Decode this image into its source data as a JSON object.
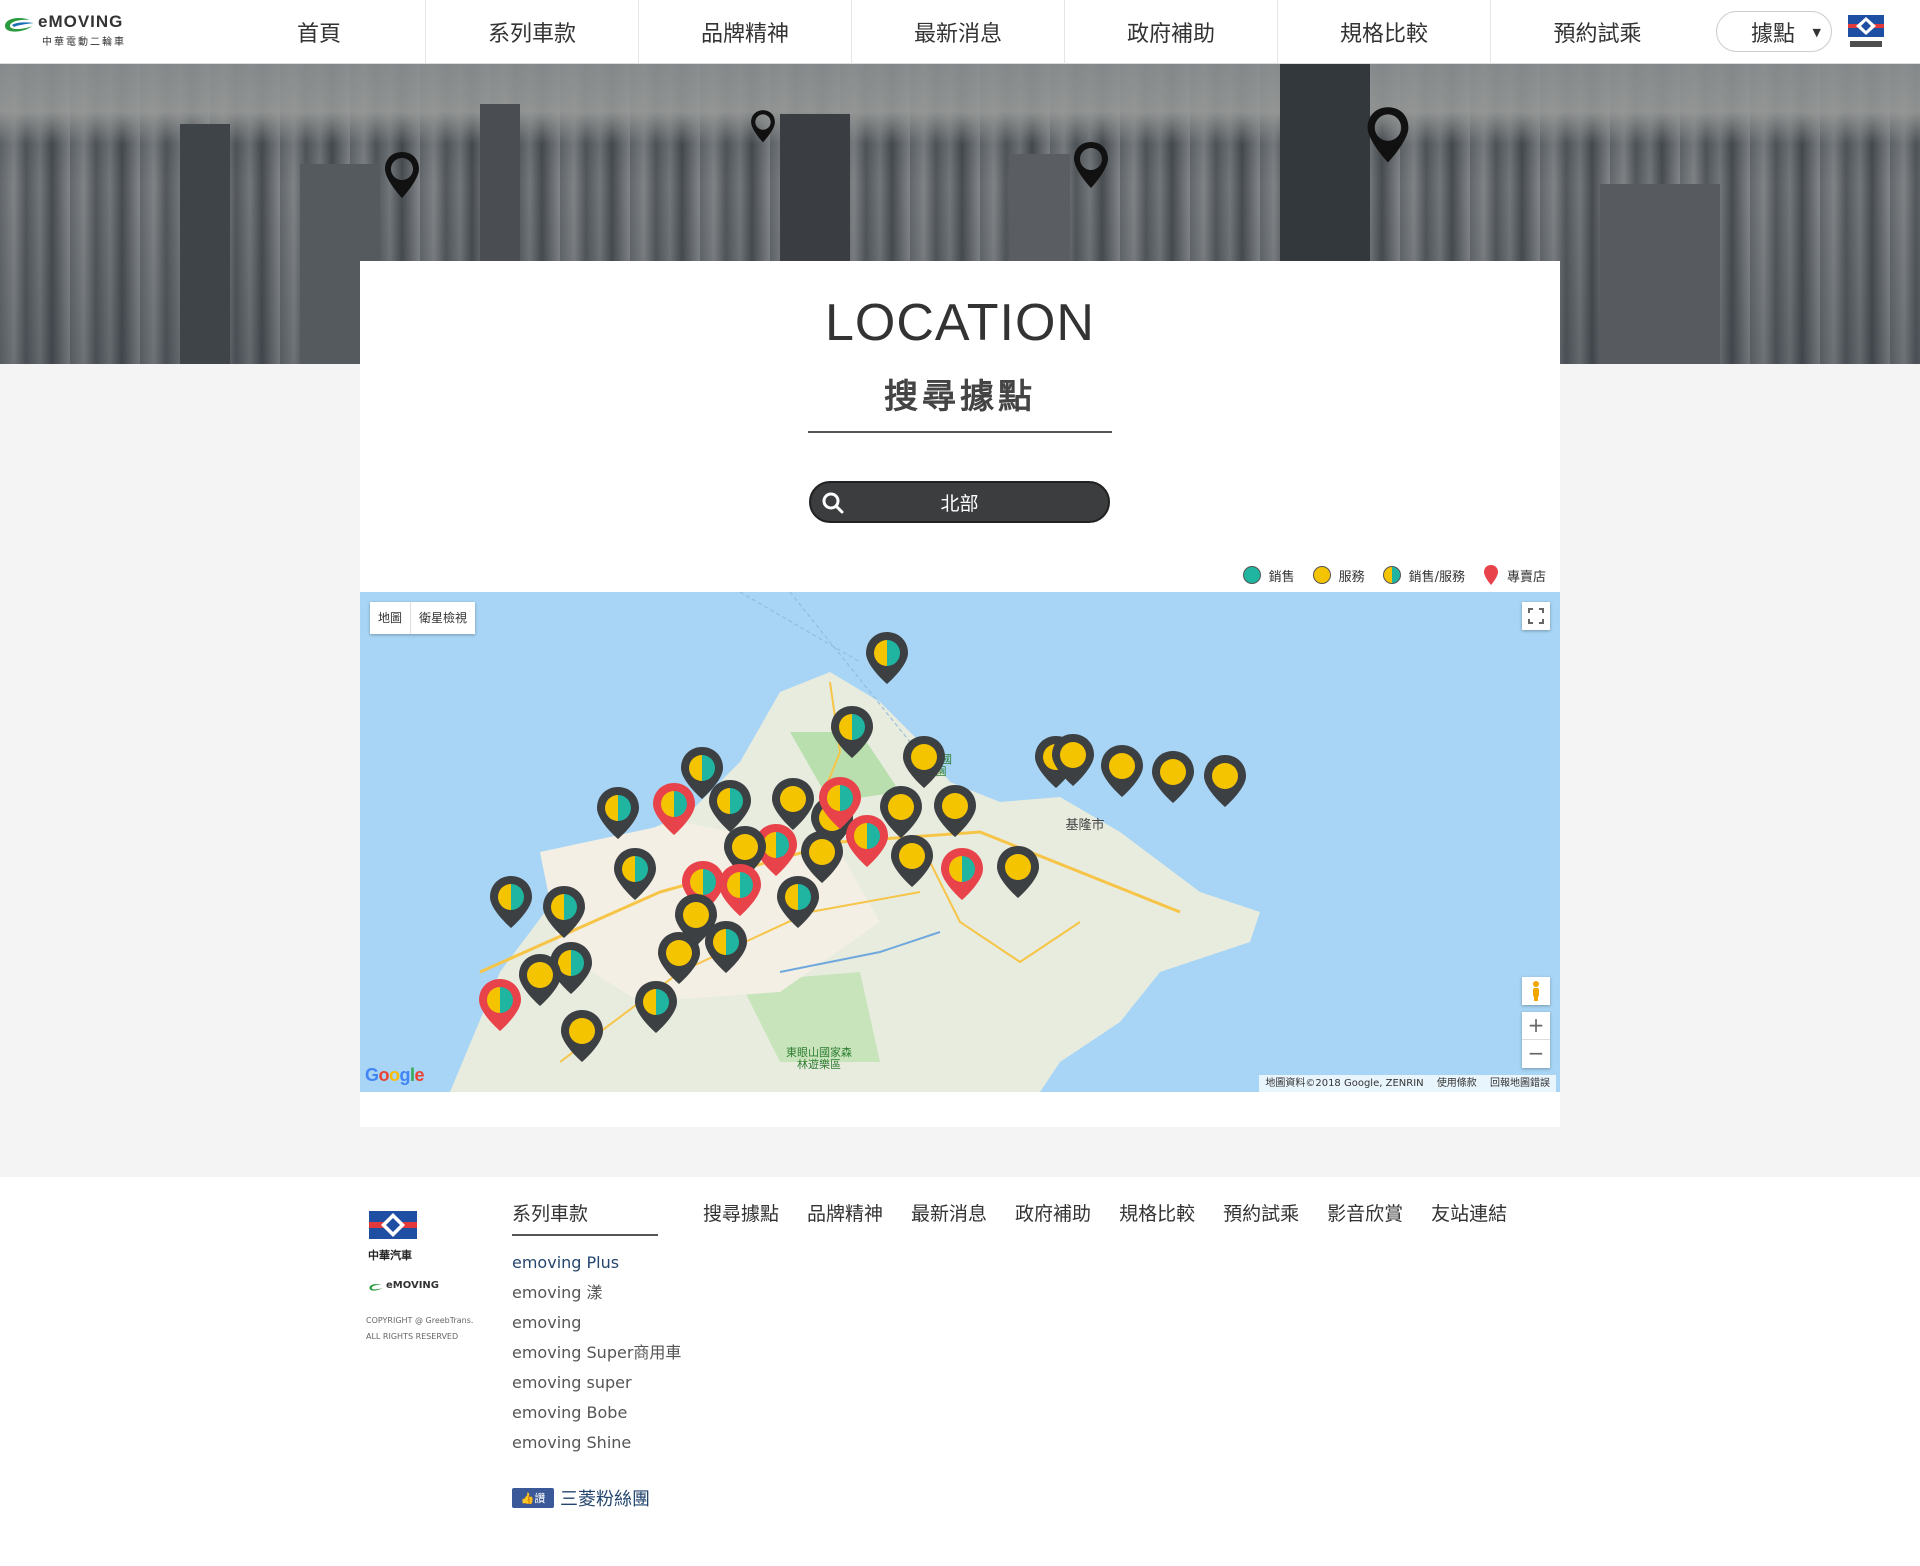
{
  "header": {
    "brand": "eMOVING",
    "tagline": "中華電動二輪車",
    "nav": [
      "首頁",
      "系列車款",
      "品牌精神",
      "最新消息",
      "政府補助",
      "規格比較",
      "預約試乘"
    ],
    "location_select": "據點",
    "cm_logo_text": "中華汽車"
  },
  "section": {
    "title_en": "LOCATION",
    "title_zh": "搜尋據點",
    "search_value": "北部"
  },
  "legend": [
    {
      "label": "銷售",
      "color": "#1fb5a0"
    },
    {
      "label": "服務",
      "color": "#f5c400"
    },
    {
      "label": "銷售/服務",
      "color": "split"
    },
    {
      "label": "專賣店",
      "color": "#e8434a"
    }
  ],
  "map": {
    "type_map": "地圖",
    "type_satellite": "衛星檢視",
    "zoom_in": "+",
    "zoom_out": "−",
    "google": "Google",
    "attribution": "地圖資料©2018 Google, ZENRIN",
    "terms": "使用條款",
    "report": "回報地圖錯誤",
    "place_labels": [
      "陽明山國家公園",
      "基隆市",
      "東眼山國家森林遊樂區"
    ]
  },
  "footer": {
    "cm_text": "中華汽車",
    "emoving": "eMOVING",
    "copyright": "COPYRIGHT @ GreebTrans. ALL RIGHTS RESERVED",
    "series_heading": "系列車款",
    "series": [
      "emoving Plus",
      "emoving 漾",
      "emoving",
      "emoving Super商用車",
      "emoving super",
      "emoving Bobe",
      "emoving Shine"
    ],
    "links": [
      "搜尋據點",
      "品牌精神",
      "最新消息",
      "政府補助",
      "規格比較",
      "預約試乘",
      "影音欣賞",
      "友站連結"
    ],
    "fb_badge": "讚",
    "fb_text": "三菱粉絲團"
  },
  "colors": {
    "sales": "#1fb5a0",
    "service": "#f5c400",
    "store": "#e8434a",
    "pin": "#3d4043"
  }
}
